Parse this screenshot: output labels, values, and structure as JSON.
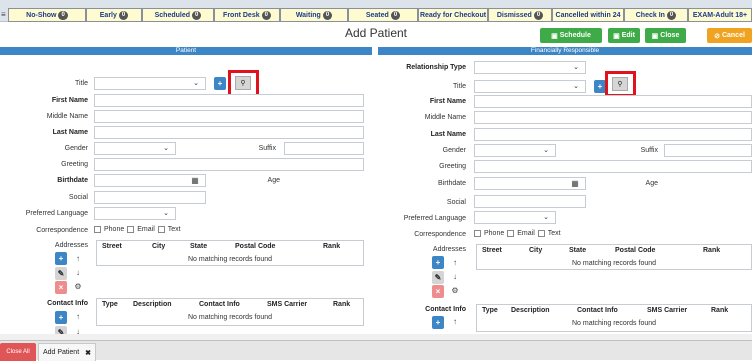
{
  "status_tabs": [
    {
      "label": "No-Show",
      "count": "0"
    },
    {
      "label": "Early",
      "count": "0"
    },
    {
      "label": "Scheduled",
      "count": "0"
    },
    {
      "label": "Front Desk",
      "count": "0"
    },
    {
      "label": "Waiting",
      "count": "0"
    },
    {
      "label": "Seated",
      "count": "0"
    },
    {
      "label": "Ready for Checkout",
      "count": ""
    },
    {
      "label": "Dismissed",
      "count": "0"
    },
    {
      "label": "Cancelled within 24",
      "count": ""
    },
    {
      "label": "Check In",
      "count": "0"
    },
    {
      "label": "EXAM-Adult 18+",
      "count": ""
    }
  ],
  "page_title": "Add Patient",
  "actions": {
    "schedule": "Schedule",
    "edit": "Edit",
    "close": "Close",
    "cancel": "Cancel"
  },
  "sections": {
    "patient": "Patient",
    "responsible": "Financially Responsible"
  },
  "labels": {
    "relationship_type": "Relationship Type",
    "title": "Title",
    "first_name": "First Name",
    "middle_name": "Middle Name",
    "last_name": "Last Name",
    "gender": "Gender",
    "suffix": "Suffix",
    "greeting": "Greeting",
    "birthdate": "Birthdate",
    "age": "Age",
    "social": "Social",
    "preferred_language": "Preferred Language",
    "correspondence": "Correspondence",
    "addresses": "Addresses",
    "contact_info": "Contact Info"
  },
  "correspondence_options": [
    "Phone",
    "Email",
    "Text"
  ],
  "address_table": {
    "columns": [
      "Street",
      "City",
      "State",
      "Postal Code",
      "Rank"
    ],
    "empty": "No matching records found"
  },
  "contact_table": {
    "columns": [
      "Type",
      "Description",
      "Contact Info",
      "SMS Carrier",
      "Rank"
    ],
    "empty": "No matching records found"
  },
  "bottom_tabs": {
    "close_all": "Close All",
    "add_patient": "Add Patient"
  }
}
